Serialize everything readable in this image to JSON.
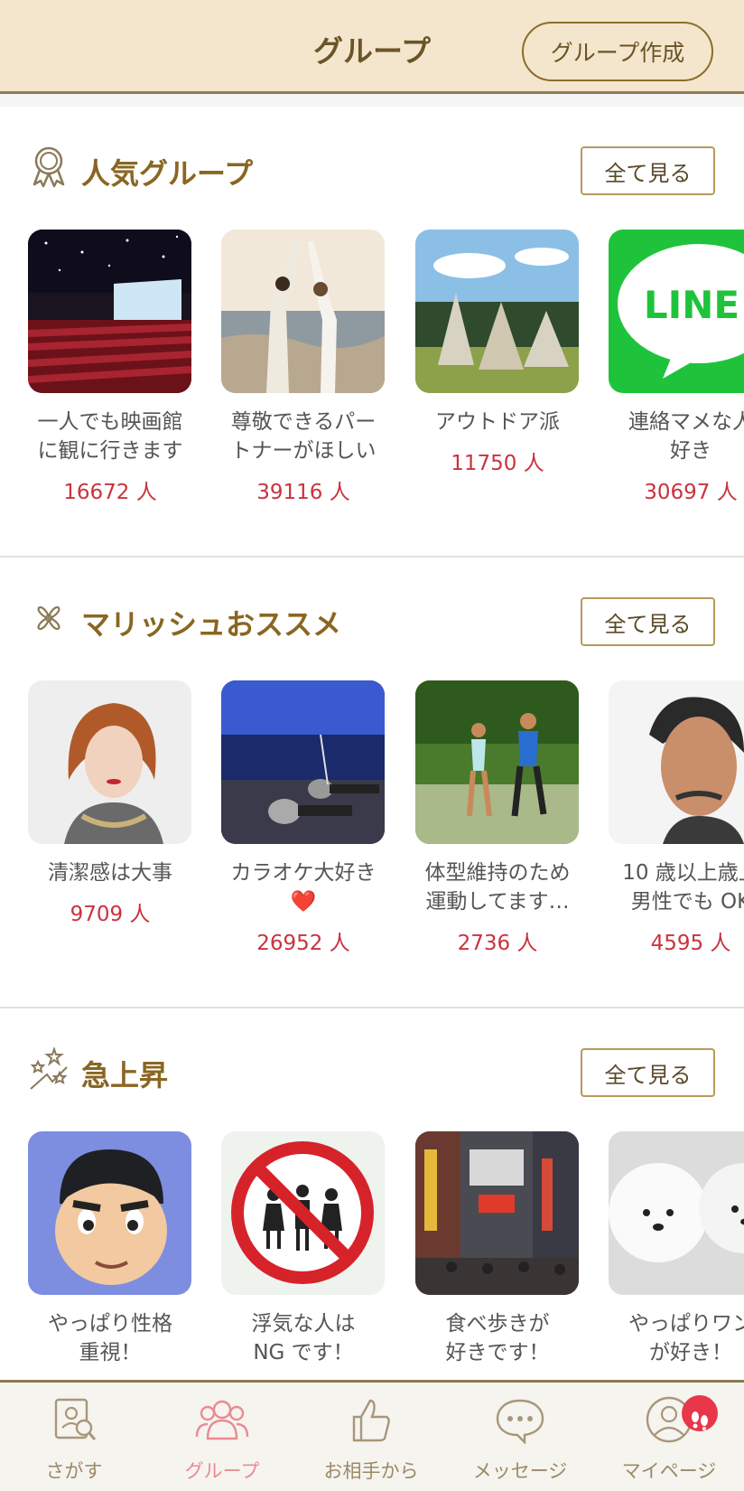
{
  "header": {
    "title": "グループ",
    "create_button": "グループ作成"
  },
  "see_all_label": "全て見る",
  "sections": [
    {
      "title": "人気グループ",
      "icon": "award-ribbon-icon",
      "cards": [
        {
          "name": "一人でも映画館\nに観に行きます",
          "count": "16672 人",
          "image": "movie-theater-photo"
        },
        {
          "name": "尊敬できるパー\nトナーがほしい",
          "count": "39116 人",
          "image": "couple-on-beach-photo"
        },
        {
          "name": "アウトドア派",
          "count": "11750 人",
          "image": "teepee-tents-photo"
        },
        {
          "name": "連絡マメな人\n好き",
          "count": "30697 人",
          "image": "line-app-logo",
          "logo_text": "LINE"
        }
      ]
    },
    {
      "title": "マリッシュおススメ",
      "icon": "clover-icon",
      "cards": [
        {
          "name": "清潔感は大事",
          "count": "9709 人",
          "image": "woman-portrait-photo"
        },
        {
          "name": "カラオケ大好き\n❤️",
          "count": "26952 人",
          "image": "karaoke-microphones-photo"
        },
        {
          "name": "体型維持のため\n運動してます…",
          "count": "2736 人",
          "image": "couple-jogging-photo"
        },
        {
          "name": "10 歳以上歳上\n男性でも OK",
          "count": "4595 人",
          "image": "older-man-portrait-photo"
        }
      ]
    },
    {
      "title": "急上昇",
      "icon": "rising-stars-icon",
      "cards": [
        {
          "name": "やっぱり性格\n重視！",
          "count": "",
          "image": "cartoon-boy-face-image"
        },
        {
          "name": "浮気な人は\nNG です！",
          "count": "",
          "image": "no-cheating-sign-image"
        },
        {
          "name": "食べ歩きが\n好きです！",
          "count": "",
          "image": "dotonbori-street-photo"
        },
        {
          "name": "やっぱりワン\nが好き！",
          "count": "",
          "image": "white-fluffy-dogs-photo"
        }
      ]
    }
  ],
  "tabs": [
    {
      "label": "さがす",
      "icon": "search-profile-icon",
      "active": false
    },
    {
      "label": "グループ",
      "icon": "group-people-icon",
      "active": true
    },
    {
      "label": "お相手から",
      "icon": "thumbs-up-icon",
      "active": false
    },
    {
      "label": "メッセージ",
      "icon": "chat-bubble-icon",
      "active": false
    },
    {
      "label": "マイページ",
      "icon": "person-circle-icon",
      "active": false
    }
  ],
  "colors": {
    "header_bg": "#f3e6cc",
    "accent_gold": "#8a6622",
    "count_red": "#c9333f",
    "active_tab": "#e98b93",
    "badge_red": "#e8364a"
  }
}
